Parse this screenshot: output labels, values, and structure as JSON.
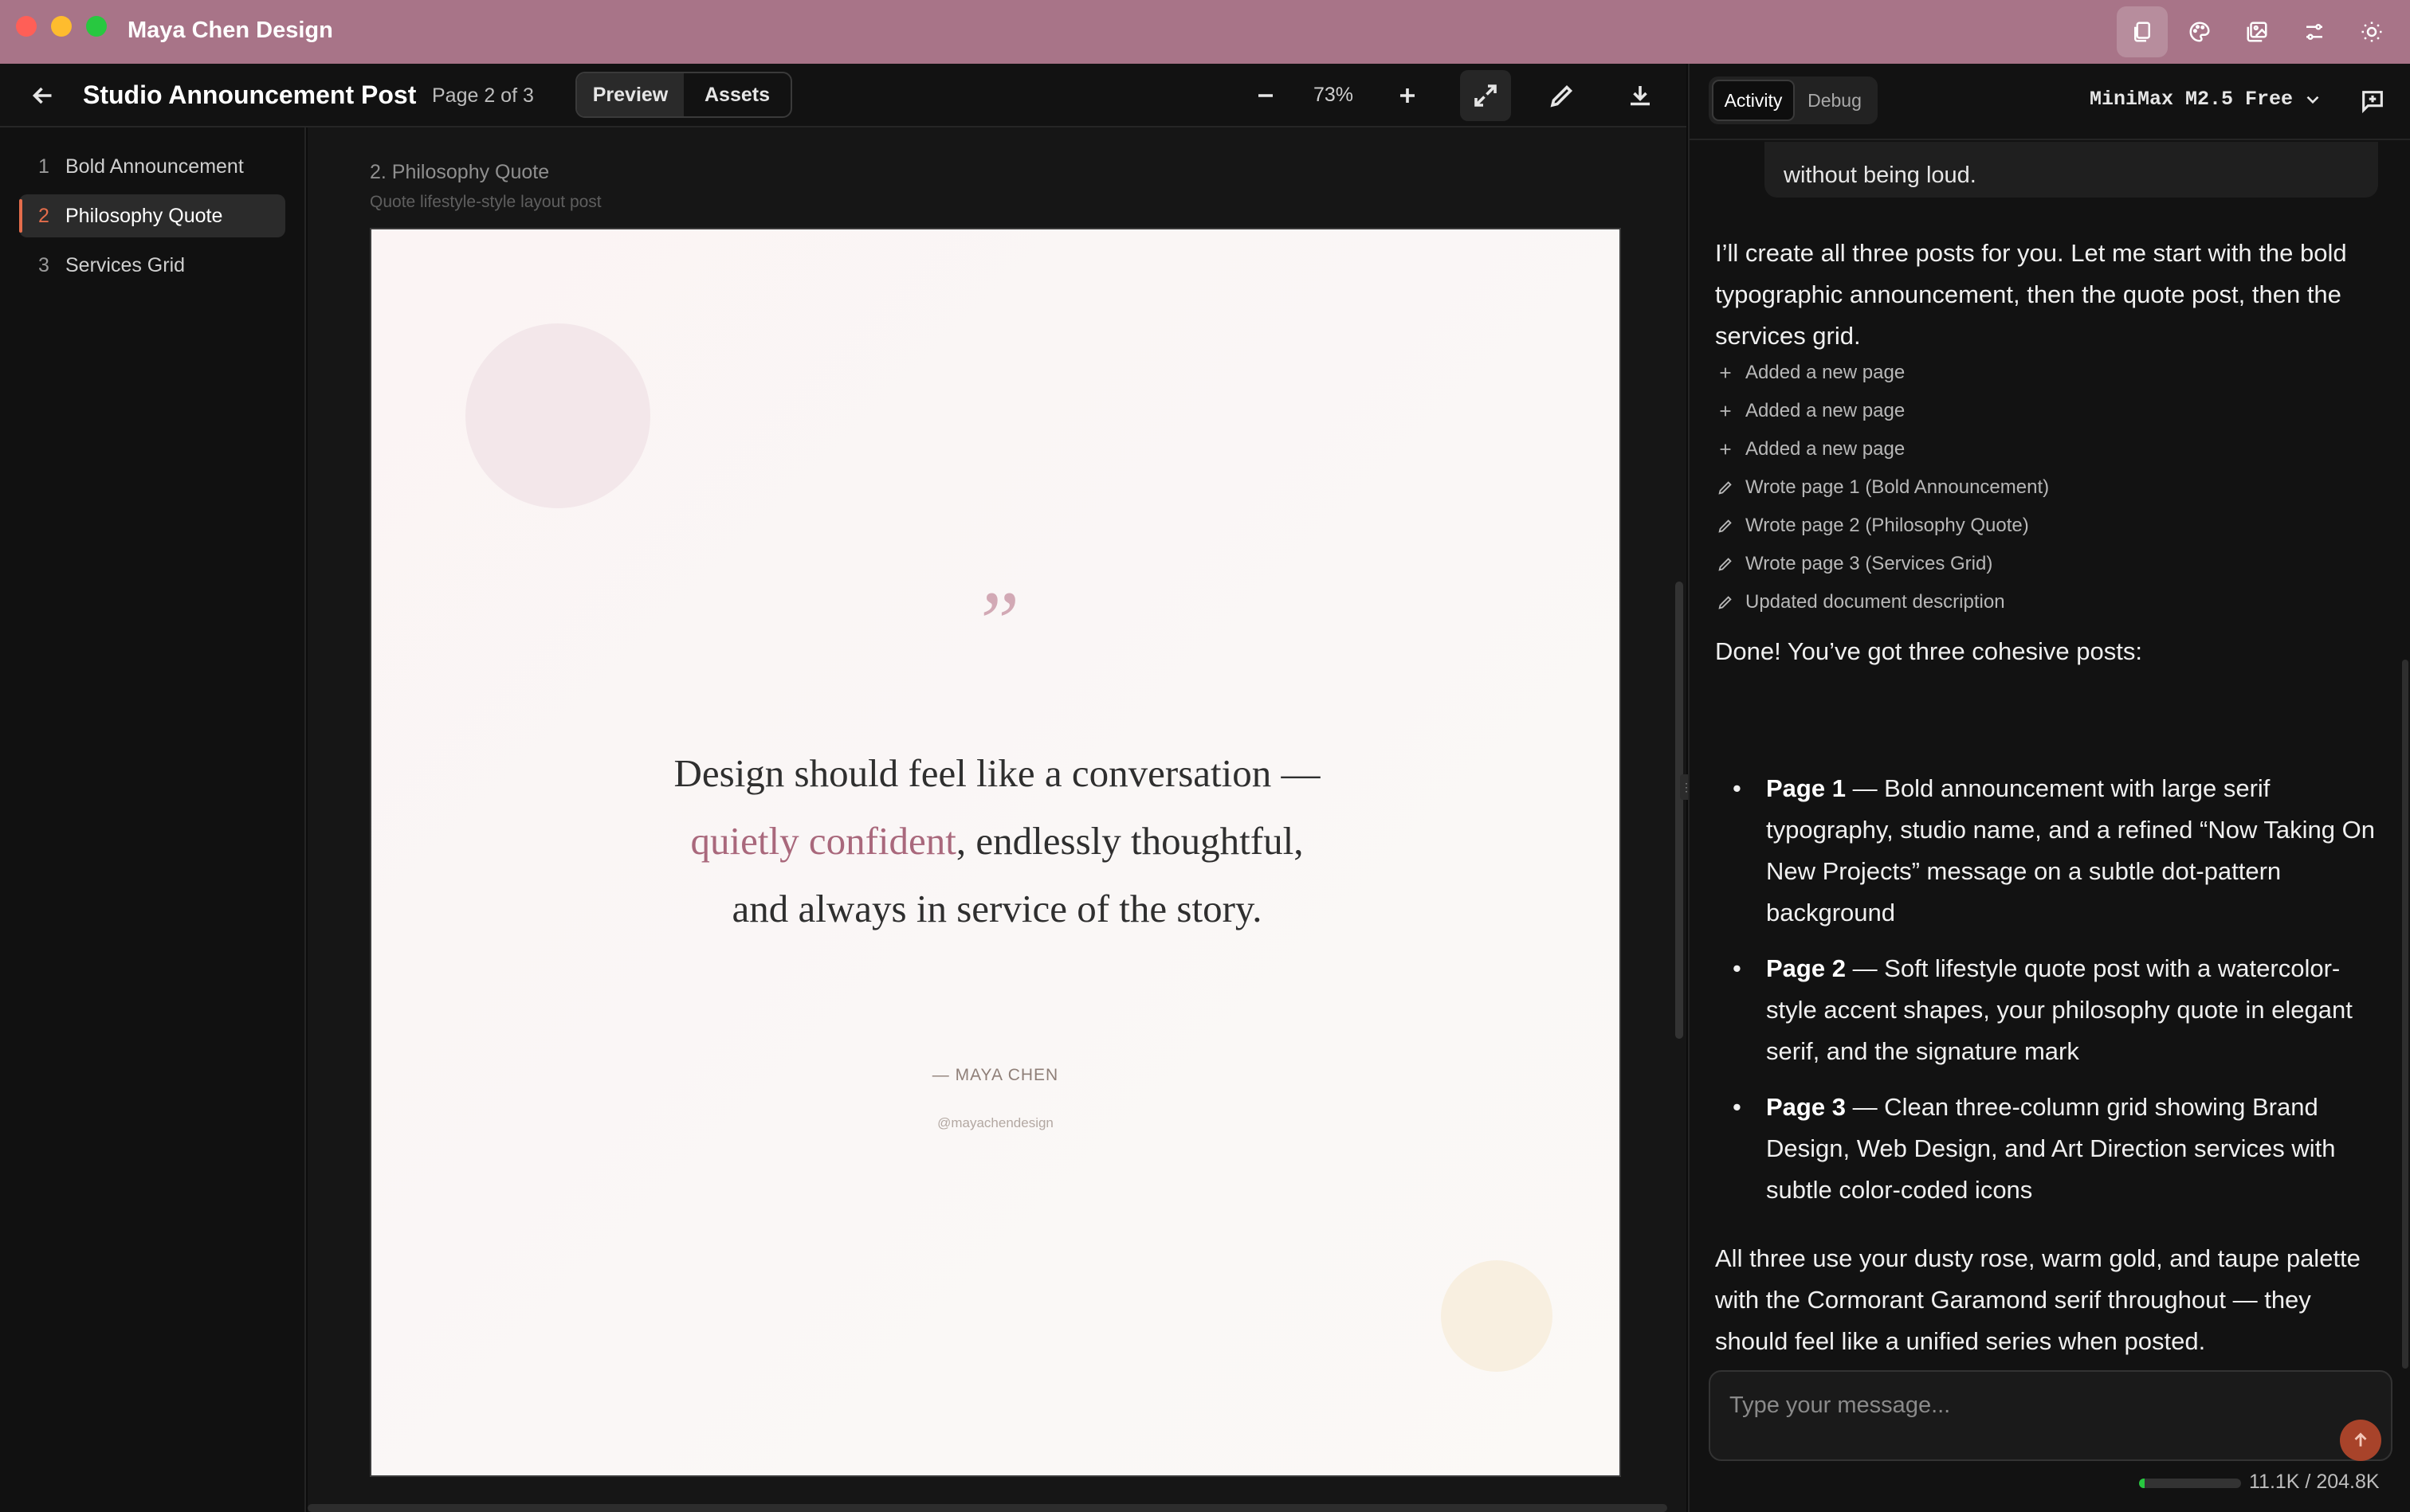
{
  "window": {
    "title": "Maya Chen Design"
  },
  "toolbar": {
    "doc_title": "Studio Announcement Post",
    "page_indicator": "Page 2 of 3",
    "view_tabs": [
      "Preview",
      "Assets"
    ],
    "active_view": "Preview",
    "zoom": "73%"
  },
  "pages": [
    {
      "num": "1",
      "label": "Bold Announcement"
    },
    {
      "num": "2",
      "label": "Philosophy Quote",
      "active": true
    },
    {
      "num": "3",
      "label": "Services Grid"
    }
  ],
  "canvas": {
    "label": "2. Philosophy Quote",
    "sublabel": "Quote lifestyle-style layout post",
    "post": {
      "quote_mark": "”",
      "quote_part1": "Design should feel like a conversation — ",
      "quote_accent": "quietly confident",
      "quote_part2": ", endlessly thoughtful, and always in service of the story.",
      "signature": "— MAYA CHEN",
      "handle": "@mayachendesign",
      "accent_color": "#a9687c"
    }
  },
  "chat": {
    "tabs": [
      "Activity",
      "Debug"
    ],
    "active_tab": "Activity",
    "model": "MiniMax M2.5 Free",
    "prev_message_tail": "without being loud.",
    "intro": "I’ll create all three posts for you. Let me start with the bold typographic announcement, then the quote post, then the services grid.",
    "activities": [
      {
        "icon": "plus-icon",
        "text": "Added a new page"
      },
      {
        "icon": "plus-icon",
        "text": "Added a new page"
      },
      {
        "icon": "plus-icon",
        "text": "Added a new page"
      },
      {
        "icon": "pencil-icon",
        "text": "Wrote page 1 (Bold Announcement)"
      },
      {
        "icon": "pencil-icon",
        "text": "Wrote page 2 (Philosophy Quote)"
      },
      {
        "icon": "pencil-icon",
        "text": "Wrote page 3 (Services Grid)"
      },
      {
        "icon": "pencil-icon",
        "text": "Updated document description"
      }
    ],
    "done_line": "Done! You’ve got three cohesive posts:",
    "bullets": [
      {
        "head": "Page 1",
        "body": " — Bold announcement with large serif typography, studio name, and a refined “Now Taking On New Projects” message on a subtle dot-pattern background"
      },
      {
        "head": "Page 2",
        "body": " — Soft lifestyle quote post with a watercolor-style accent shapes, your philosophy quote in elegant serif, and the signature mark"
      },
      {
        "head": "Page 3",
        "body": " — Clean three-column grid showing Brand Design, Web Design, and Art Direction services with subtle color-coded icons"
      }
    ],
    "closing": "All three use your dusty rose, warm gold, and taupe palette with the Cormorant Garamond serif throughout — they should feel like a unified series when posted.",
    "composer_placeholder": "Type your message...",
    "token_usage": "11.1K / 204.8K",
    "token_fraction": 0.054
  }
}
